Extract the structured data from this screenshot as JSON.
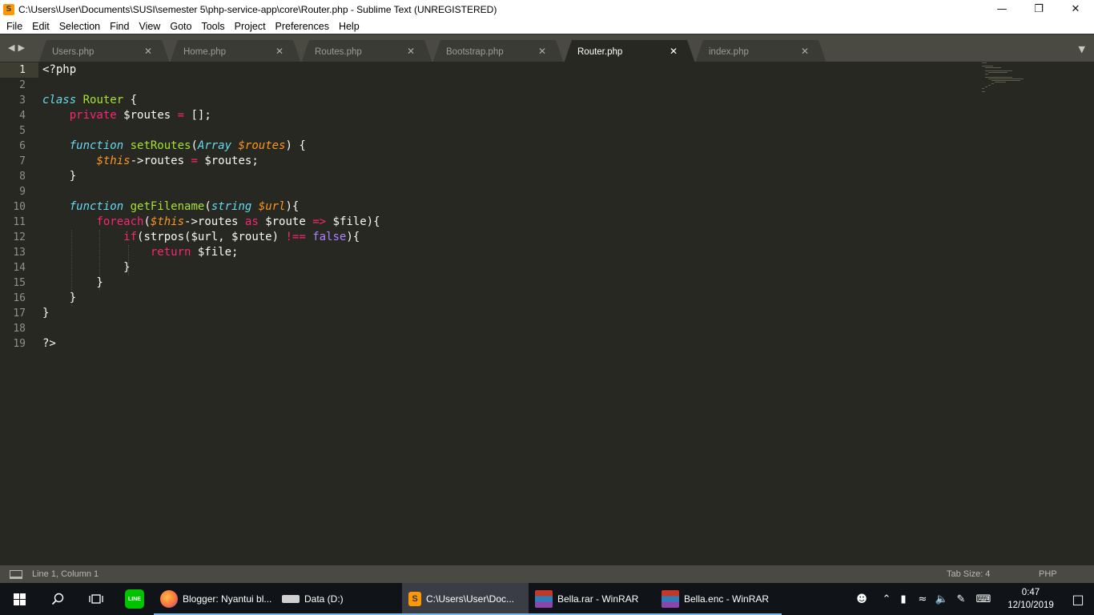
{
  "window": {
    "title": "C:\\Users\\User\\Documents\\SUSI\\semester 5\\php-service-app\\core\\Router.php - Sublime Text (UNREGISTERED)",
    "app_icon_glyph": "S",
    "minimize_glyph": "—",
    "maximize_glyph": "❐",
    "close_glyph": "✕"
  },
  "menu": [
    "File",
    "Edit",
    "Selection",
    "Find",
    "View",
    "Goto",
    "Tools",
    "Project",
    "Preferences",
    "Help"
  ],
  "tabs": [
    {
      "label": "Users.php",
      "active": false
    },
    {
      "label": "Home.php",
      "active": false
    },
    {
      "label": "Routes.php",
      "active": false
    },
    {
      "label": "Bootstrap.php",
      "active": false
    },
    {
      "label": "Router.php",
      "active": true
    },
    {
      "label": "index.php",
      "active": false
    }
  ],
  "tab_close_glyph": "✕",
  "nav_glyphs": {
    "back": "◀",
    "forward": "▶",
    "dropdown": "▼"
  },
  "editor": {
    "current_line": 1,
    "line_numbers": [
      "1",
      "2",
      "3",
      "4",
      "5",
      "6",
      "7",
      "8",
      "9",
      "10",
      "11",
      "12",
      "13",
      "14",
      "15",
      "16",
      "17",
      "18",
      "19"
    ],
    "code_lines": [
      "<?php",
      "",
      "class Router {",
      "    private $routes = [];",
      "",
      "    function setRoutes(Array $routes) {",
      "        $this->routes = $routes;",
      "    }",
      "",
      "    function getFilename(string $url){",
      "        foreach($this->routes as $route => $file){",
      "            if(strpos($url, $route) !== false){",
      "                return $file;",
      "            }",
      "        }",
      "    }",
      "}",
      "",
      "?>"
    ]
  },
  "status": {
    "position": "Line 1, Column 1",
    "tab_size": "Tab Size: 4",
    "syntax": "PHP"
  },
  "taskbar": {
    "apps": [
      {
        "label": "Blogger: Nyantui bl...",
        "icon": "firefox-icon",
        "color": "#ff7139",
        "active": false
      },
      {
        "label": "Data (D:)",
        "icon": "drive-icon",
        "color": "#c8c8c8",
        "active": false
      },
      {
        "label": "C:\\Users\\User\\Doc...",
        "icon": "sublime-icon",
        "color": "#ff9800",
        "active": true
      },
      {
        "label": "Bella.rar - WinRAR",
        "icon": "winrar-icon",
        "color": "#9b59b6",
        "active": false
      },
      {
        "label": "Bella.enc - WinRAR",
        "icon": "winrar-icon",
        "color": "#9b59b6",
        "active": false
      }
    ],
    "line_label": "LINE",
    "time": "0:47",
    "date": "12/10/2019"
  }
}
